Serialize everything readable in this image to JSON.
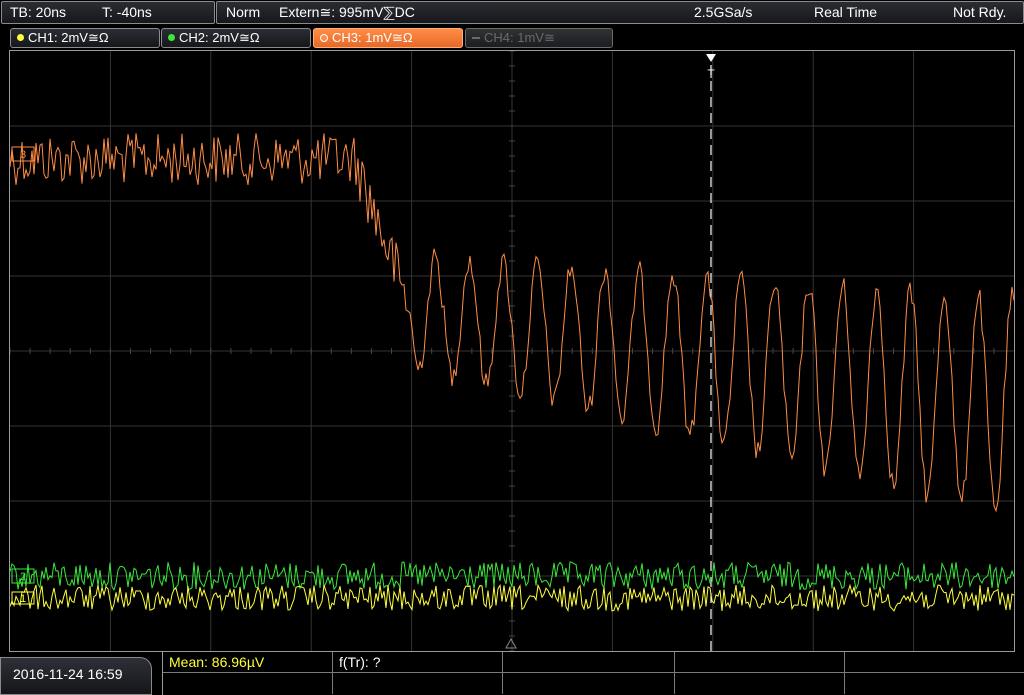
{
  "status": {
    "timebase": "TB: 20ns",
    "trigger_time": "T: -40ns",
    "trigger_mode": "Norm",
    "trigger_source": "Extern≅: 995mV⅀DC",
    "sample_rate": "2.5GSa/s",
    "acq_mode": "Real Time",
    "state": "Not Rdy."
  },
  "channels": [
    {
      "label": "CH1: 2mV≅Ω",
      "color": "#ffff3c",
      "state": "on"
    },
    {
      "label": "CH2: 2mV≅Ω",
      "color": "#39e83a",
      "state": "on"
    },
    {
      "label": "CH3: 1mV≅Ω",
      "color": "#ff8d45",
      "state": "selected"
    },
    {
      "label": "CH4: 1mV≅",
      "color": "#6a6a6a",
      "state": "off"
    }
  ],
  "trigger_marker": "T",
  "markers": {
    "ch1": "1",
    "ch2": "2",
    "ch3": "3"
  },
  "colors": {
    "ch1": "#ffff3c",
    "ch2": "#39e83a",
    "ch3": "#ff8d45",
    "grid": "#3a3a3a",
    "trigger_line": "#ffffff"
  },
  "footer": {
    "datetime": "2016-11-24 16:59",
    "measurement_1": "Mean: 86.96µV",
    "measurement_2": "f(Tr): ?"
  }
}
